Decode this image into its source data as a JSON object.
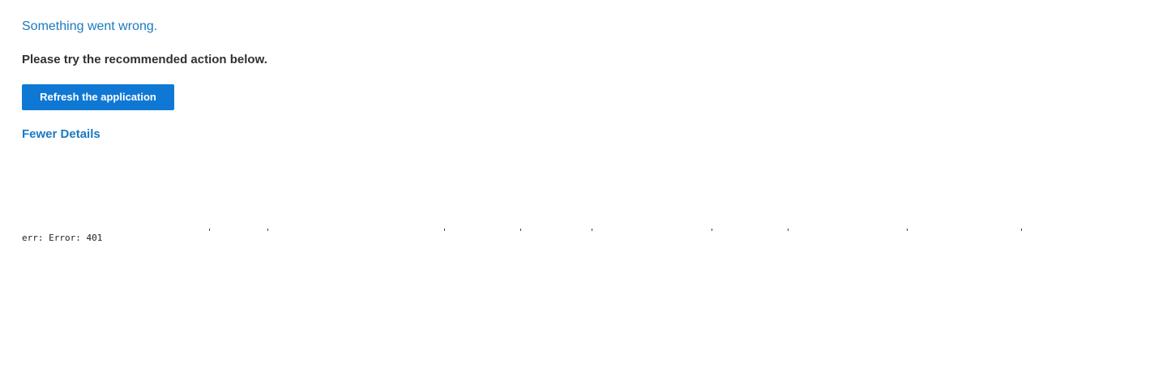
{
  "error_page": {
    "headline": "Something went wrong.",
    "instruction": "Please try the recommended action below.",
    "refresh_button_label": "Refresh the application",
    "details_toggle_label": "Fewer Details",
    "error_detail": "err: Error: 401"
  }
}
